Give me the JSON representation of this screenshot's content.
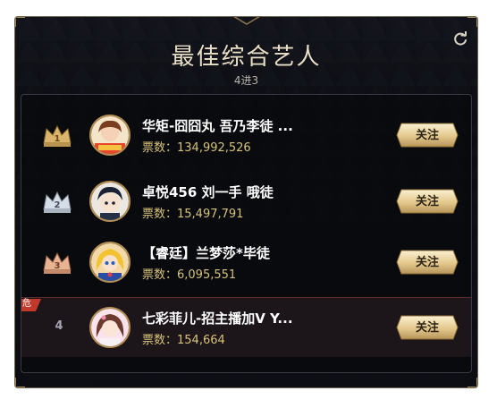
{
  "header": {
    "title": "最佳综合艺人",
    "subtitle": "4进3",
    "refresh_icon": "refresh-icon"
  },
  "ranking": [
    {
      "rank": "1",
      "name": "华矩-囧囧丸 吾乃李徒 ...",
      "votes": "票数：134,992,526",
      "follow": "关注",
      "crown": "gold-crown-icon",
      "danger": false
    },
    {
      "rank": "2",
      "name": "卓悦456 刘一手 哦徒",
      "votes": "票数：15,497,791",
      "follow": "关注",
      "crown": "silver-crown-icon",
      "danger": false
    },
    {
      "rank": "3",
      "name": "【睿廷】兰梦莎*毕徒",
      "votes": "票数：6,095,551",
      "follow": "关注",
      "crown": "bronze-crown-icon",
      "danger": false
    },
    {
      "rank": "4",
      "name": "七彩菲儿-招主播加V Y...",
      "votes": "票数：154,664",
      "follow": "关注",
      "danger": true,
      "danger_label": "危"
    }
  ],
  "colors": {
    "gold": "#d8c27a",
    "panel_bg": "#0d0e14",
    "danger_row": "#1c1519",
    "danger_tag": "#c0392b"
  }
}
